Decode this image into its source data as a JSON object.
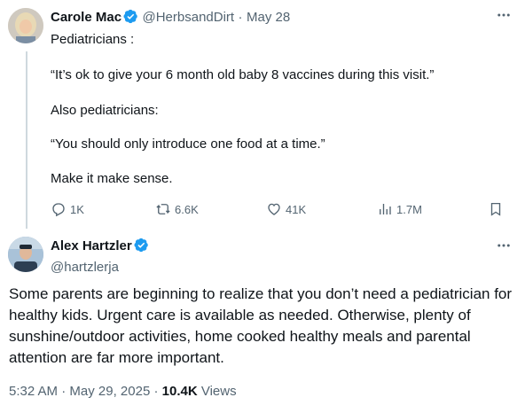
{
  "quoted_tweet": {
    "author_name": "Carole Mac",
    "handle": "@HerbsandDirt",
    "separator": "·",
    "date": "May 28",
    "lines": [
      "Pediatricians :",
      "“It’s ok to give your 6 month old baby 8 vaccines during this visit.”",
      "Also pediatricians:",
      "“You should only introduce one food at a time.”",
      "Make it make sense."
    ],
    "stats": {
      "replies": "1K",
      "reposts": "6.6K",
      "likes": "41K",
      "views": "1.7M"
    }
  },
  "main_tweet": {
    "author_name": "Alex Hartzler",
    "handle": "@hartzlerja",
    "text": "Some parents are beginning to realize that you don’t need a pediatrician for healthy kids. Urgent care is available as needed. Otherwise, plenty of sunshine/outdoor activities, home cooked healthy meals and parental attention are far more important.",
    "time": "5:32 AM",
    "separator1": " · ",
    "date": "May 29, 2025",
    "separator2": " · ",
    "views_count": "10.4K",
    "views_label": " Views"
  },
  "icons": {
    "verified": "verified-badge-icon",
    "more": "more-dots-icon",
    "reply": "reply-icon",
    "repost": "repost-icon",
    "like": "heart-icon",
    "views": "analytics-icon",
    "bookmark": "bookmark-icon"
  },
  "colors": {
    "verified_blue": "#1d9bf0",
    "muted_text": "#536471",
    "primary_text": "#0f1419"
  }
}
